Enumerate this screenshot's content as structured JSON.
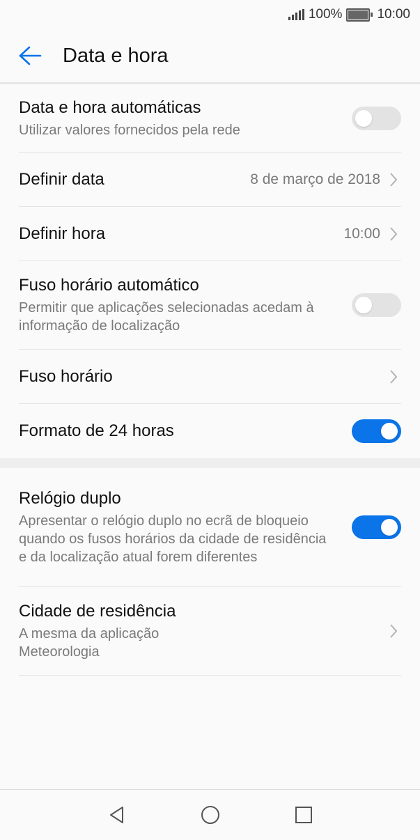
{
  "status_bar": {
    "battery": "100%",
    "time": "10:00",
    "icons": [
      "signal-icon",
      "battery-icon"
    ]
  },
  "app_bar": {
    "title": "Data e hora",
    "back_icon": "arrow-left-icon"
  },
  "settings": {
    "auto_datetime": {
      "label": "Data e hora automáticas",
      "sub": "Utilizar valores fornecidos pela rede",
      "enabled": false
    },
    "set_date": {
      "label": "Definir data",
      "value": "8 de março de 2018"
    },
    "set_time": {
      "label": "Definir hora",
      "value": "10:00"
    },
    "auto_timezone": {
      "label": "Fuso horário automático",
      "sub": "Permitir que aplicações selecionadas acedam à informação de localização",
      "enabled": false
    },
    "timezone": {
      "label": "Fuso horário"
    },
    "format_24h": {
      "label": "Formato de 24 horas",
      "enabled": true
    },
    "dual_clock": {
      "label": "Relógio duplo",
      "sub": "Apresentar o relógio duplo no ecrã de bloqueio quando os fusos horários da cidade de residência e da localização atual forem diferentes",
      "enabled": true
    },
    "home_city": {
      "label": "Cidade de residência",
      "sub": "A mesma da aplicação Meteorologia"
    }
  },
  "nav_bar": {
    "icons": [
      "back-triangle-icon",
      "home-circle-icon",
      "recents-square-icon"
    ]
  },
  "colors": {
    "accent": "#0a74e8",
    "toggle_off": "#e3e3e3"
  }
}
